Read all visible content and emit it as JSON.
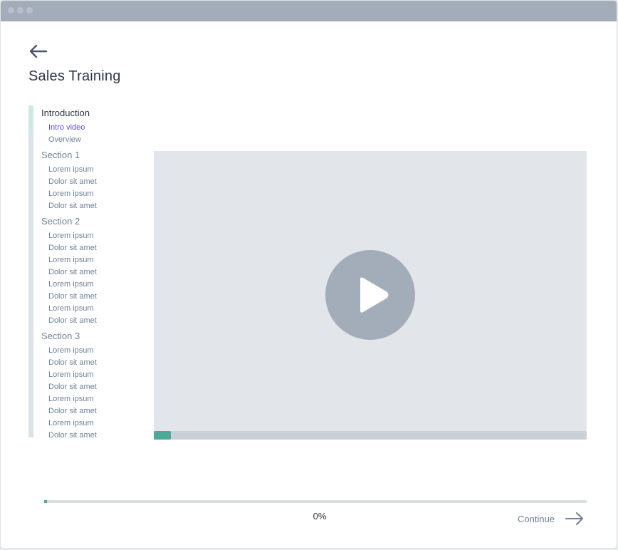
{
  "page": {
    "title": "Sales Training"
  },
  "icons": {
    "back": "arrow-left-icon",
    "play": "play-icon",
    "continue": "arrow-right-icon"
  },
  "colors": {
    "accent": "#4ea89a",
    "active_link": "#5a51d6",
    "chrome": "#a3adb9"
  },
  "sidebar": {
    "sections": [
      {
        "title": "Introduction",
        "current": true,
        "items": [
          {
            "label": "Intro video",
            "current": true
          },
          {
            "label": "Overview"
          }
        ]
      },
      {
        "title": "Section 1",
        "items": [
          {
            "label": "Lorem ipsum"
          },
          {
            "label": "Dolor sit amet"
          },
          {
            "label": "Lorem ipsum"
          },
          {
            "label": "Dolor sit amet"
          }
        ]
      },
      {
        "title": "Section 2",
        "items": [
          {
            "label": "Lorem ipsum"
          },
          {
            "label": "Dolor sit amet"
          },
          {
            "label": "Lorem ipsum"
          },
          {
            "label": "Dolor sit amet"
          },
          {
            "label": "Lorem ipsum"
          },
          {
            "label": "Dolor sit amet"
          },
          {
            "label": "Lorem ipsum"
          },
          {
            "label": "Dolor sit amet"
          }
        ]
      },
      {
        "title": "Section 3",
        "items": [
          {
            "label": "Lorem ipsum"
          },
          {
            "label": "Dolor sit amet"
          },
          {
            "label": "Lorem ipsum"
          },
          {
            "label": "Dolor sit amet"
          },
          {
            "label": "Lorem ipsum"
          },
          {
            "label": "Dolor sit amet"
          },
          {
            "label": "Lorem ipsum"
          },
          {
            "label": "Dolor sit amet"
          }
        ]
      }
    ]
  },
  "video": {
    "progress": 0.04
  },
  "footer": {
    "progress_text": "0%",
    "progress": 0.005,
    "continue_label": "Continue"
  }
}
